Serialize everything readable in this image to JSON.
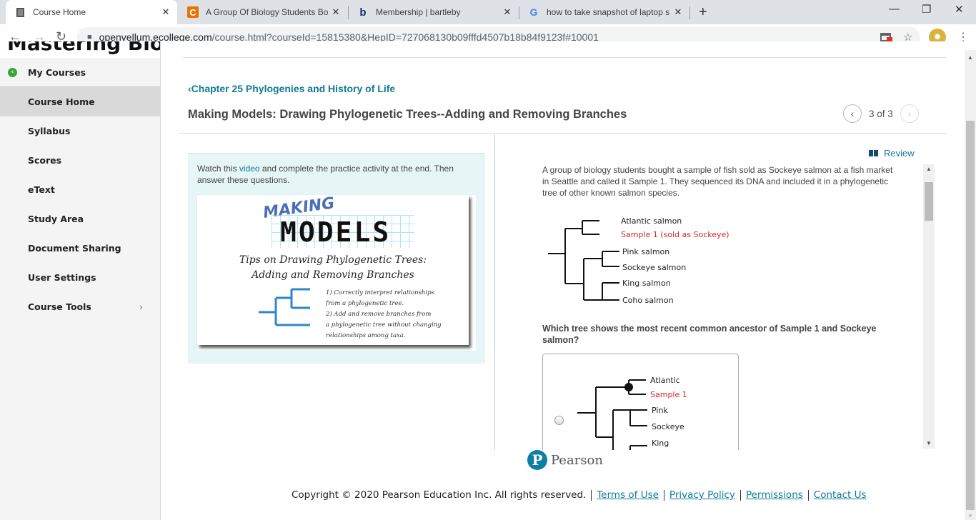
{
  "browser": {
    "tabs": [
      {
        "title": "Course Home",
        "icon": "page-icon",
        "active": true
      },
      {
        "title": "A Group Of Biology Students Bou",
        "icon": "chegg-icon",
        "glyph": "C"
      },
      {
        "title": "Membership | bartleby",
        "icon": "bartleby-icon",
        "glyph": "b"
      },
      {
        "title": "how to take snapshot of laptop s",
        "icon": "google-icon",
        "glyph": "G"
      }
    ],
    "close_glyph": "✕",
    "new_tab_glyph": "+",
    "window_controls": {
      "minimize": "—",
      "restore": "❐",
      "close": "✕"
    },
    "nav": {
      "back": "←",
      "forward": "→",
      "reload": "↻"
    },
    "url_host": "openvellum.ecollege.com",
    "url_path": "/course.html?courseId=15815380&HepID=727068130b09fffd4507b18b84f9123f#10001",
    "lock_glyph": "🔒",
    "star_glyph": "☆",
    "menu_glyph": "⋮",
    "avatar_glyph": "✹"
  },
  "sidebar": {
    "brand": "Mastering Biology",
    "back_glyph": "‹",
    "items": [
      {
        "label": "My Courses"
      },
      {
        "label": "Course Home",
        "active": true
      },
      {
        "label": "Syllabus"
      },
      {
        "label": "Scores"
      },
      {
        "label": "eText"
      },
      {
        "label": "Study Area"
      },
      {
        "label": "Document Sharing"
      },
      {
        "label": "User Settings"
      },
      {
        "label": "Course Tools",
        "chevron": "›"
      }
    ]
  },
  "main": {
    "chapter_link": "Chapter 25 Phylogenies and History of Life",
    "chapter_glyph": "‹",
    "title": "Making Models: Drawing Phylogenetic Trees--Adding and Removing Branches",
    "pager": {
      "prev": "‹",
      "next": "›",
      "text": "3 of 3"
    },
    "intro": {
      "before": "Watch this ",
      "link": "video",
      "after": " and complete the practice activity at the end. Then answer these questions."
    },
    "video": {
      "making": "MAKING",
      "models": "MODELS",
      "subtitle_1": "Tips on Drawing Phylogenetic Trees:",
      "subtitle_2": "Adding and Removing Branches",
      "point_1a": "1) Correctly interpret relationships",
      "point_1b": "from a phylogenetic tree.",
      "point_2a": "2) Add and remove branches from",
      "point_2b": "a phylogenetic tree without changing",
      "point_2c": "relationships among taxa."
    },
    "review_label": "Review",
    "question_text": "A group of biology students bought a sample of fish sold as Sockeye salmon at a fish market in Seattle and called it Sample 1. They sequenced its DNA and included it in a phylogenetic tree of other known salmon species.",
    "tree": {
      "taxa": [
        "Atlantic salmon",
        "Sample 1 (sold as Sockeye)",
        "Pink salmon",
        "Sockeye salmon",
        "King salmon",
        "Coho salmon"
      ],
      "highlight_color": "#d9262e"
    },
    "question_stem": "Which tree shows the most recent common ancestor of Sample 1 and Sockeye salmon?",
    "choice_1": {
      "taxa": [
        "Atlantic",
        "Sample 1",
        "Pink",
        "Sockeye",
        "King"
      ],
      "selected": false
    }
  },
  "footer": {
    "brand": "Pearson",
    "logo_glyph": "P",
    "copyright": "Copyright © 2020 Pearson Education Inc. All rights reserved.",
    "links": [
      "Terms of Use",
      "Privacy Policy",
      "Permissions",
      "Contact Us"
    ]
  },
  "colors": {
    "accent": "#107b98",
    "sample_red": "#d9262e",
    "nav_active": "#d9d9d9"
  }
}
